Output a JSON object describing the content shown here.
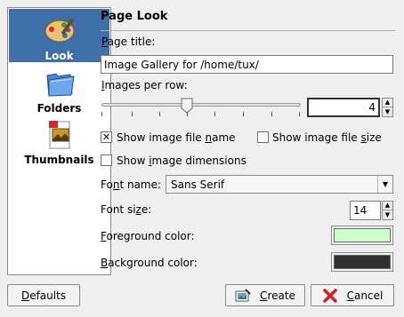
{
  "sidebar": {
    "items": [
      {
        "label": "Look",
        "icon": "palette-icon",
        "selected": true
      },
      {
        "label": "Folders",
        "icon": "folder-icon",
        "selected": false
      },
      {
        "label": "Thumbnails",
        "icon": "thumbnail-image-icon",
        "selected": false
      }
    ]
  },
  "page": {
    "title": "Page Look",
    "page_title_label_u": "P",
    "page_title_label_rest": "age title:",
    "page_title_value": "Image Gallery for /home/tux/",
    "images_per_row_label_u": "I",
    "images_per_row_label_rest": "mages per row:",
    "images_per_row_value": "4",
    "show_file_name_pre": "Show image file ",
    "show_file_name_u": "n",
    "show_file_name_post": "ame",
    "show_file_name_checked": true,
    "show_file_size_pre": "Show image file ",
    "show_file_size_u": "s",
    "show_file_size_post": "ize",
    "show_file_size_checked": false,
    "show_dimensions_pre": "Show ",
    "show_dimensions_u": "i",
    "show_dimensions_post": "mage dimensions",
    "show_dimensions_checked": false,
    "font_name_label_pre": "Fo",
    "font_name_label_u": "n",
    "font_name_label_post": "t name:",
    "font_name_value": "Sans Serif",
    "font_size_label_pre": "Font si",
    "font_size_label_u": "z",
    "font_size_label_post": "e:",
    "font_size_value": "14",
    "fg_label_u": "F",
    "fg_label_rest": "oreground color:",
    "fg_color": "#ccffcc",
    "bg_label_u": "B",
    "bg_label_rest": "ackground color:",
    "bg_color": "#303030"
  },
  "footer": {
    "defaults_u": "D",
    "defaults_rest": "efaults",
    "create_u": "C",
    "create_rest": "reate",
    "cancel_u": "C",
    "cancel_rest": "ancel"
  },
  "colors": {
    "selection": "#3e6fa8",
    "cancel_icon": "#d42020"
  }
}
